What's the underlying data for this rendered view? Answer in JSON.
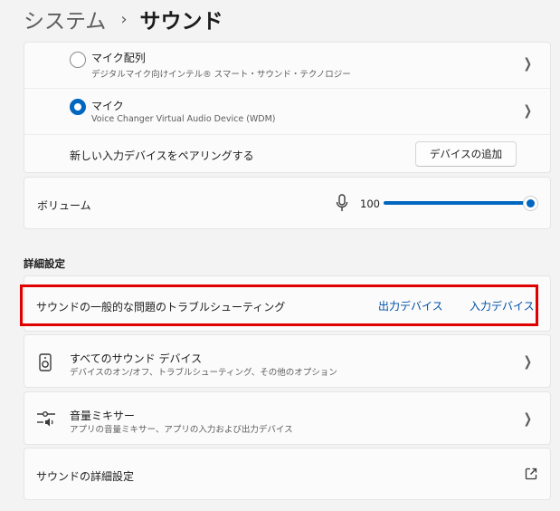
{
  "breadcrumb": {
    "parent": "システム",
    "separator": "›",
    "current": "サウンド"
  },
  "input_devices": [
    {
      "name": "マイク配列",
      "description": "デジタルマイク向けインテル® スマート・サウンド・テクノロジー",
      "selected": false
    },
    {
      "name": "マイク",
      "description": "Voice Changer Virtual Audio Device (WDM)",
      "selected": true
    }
  ],
  "pairing": {
    "label": "新しい入力デバイスをペアリングする",
    "button_label": "デバイスの追加"
  },
  "volume": {
    "label": "ボリューム",
    "value": "100",
    "level": 1.0,
    "icon": "microphone-icon"
  },
  "advanced": {
    "section_title": "詳細設定",
    "troubleshoot": {
      "label": "サウンドの一般的な問題のトラブルシューティング",
      "output_link": "出力デバイス",
      "input_link": "入力デバイス"
    },
    "all_devices": {
      "title": "すべてのサウンド デバイス",
      "subtitle": "デバイスのオン/オフ、トラブルシューティング、その他のオプション",
      "icon": "speaker-icon"
    },
    "mixer": {
      "title": "音量ミキサー",
      "subtitle": "アプリの音量ミキサー、アプリの入力および出力デバイス",
      "icon": "mixer-icon"
    },
    "more_settings": {
      "label": "サウンドの詳細設定",
      "icon": "external-link-icon"
    }
  },
  "colors": {
    "accent": "#0067c0",
    "highlight_box": "#e00000"
  }
}
